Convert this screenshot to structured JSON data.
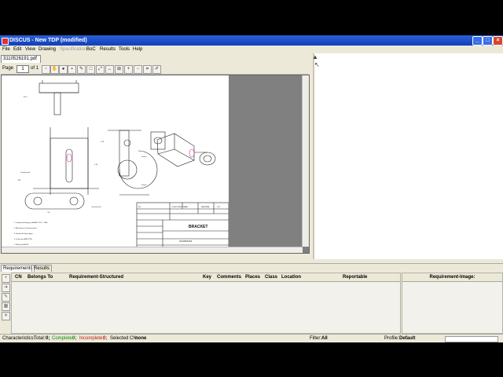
{
  "window": {
    "title": "DISCUS - New TDP (modified)",
    "controls": [
      "_",
      "□",
      "×"
    ]
  },
  "menu": [
    "File",
    "Edit",
    "View",
    "Drawing",
    "Specification",
    "BoC",
    "Results",
    "Tools",
    "Help"
  ],
  "document": {
    "tab_label": "3110526191.pdf",
    "toolbar": {
      "page_label": "Page",
      "page_value": "1",
      "page_of": "of 1"
    }
  },
  "drawing": {
    "title_block_title": "BRACKET",
    "part_number": "3110526191",
    "notes": [
      "1. Interpret drawing per ASME Y14.5 - 1994.",
      "2. All surfaces 63 microinches.",
      "3. Break all sharp edges.",
      "4. Finish per AMS 2700.",
      "5. Mark per AS478."
    ]
  },
  "bottom": {
    "tabs": [
      "Requirements",
      "Results"
    ],
    "active_tab": "Requirements",
    "grid_columns": [
      "CN",
      "Belongs To",
      "Requirement-Structured",
      "Key",
      "Comments",
      "Places",
      "Class",
      "Location",
      "Reportable"
    ],
    "image_panel_title": "Requirement-Image:"
  },
  "status": {
    "characteristics_label": "Characteristics:",
    "total_label": "Total:",
    "total_value": "0;",
    "complete_label": "Complete:",
    "complete_value": "0;",
    "incomplete_label": "Incomplete:",
    "incomplete_value": "0;",
    "selected_label": "Selected CN:",
    "selected_value": "none",
    "filter_label": "Filter:",
    "filter_value": "All",
    "profile_label": "Profile:",
    "profile_value": "Default"
  },
  "colors": {
    "titlebar": "#1f54d0",
    "complete": "#0a8a0a",
    "incomplete": "#c01818",
    "viewer_background": "#808080"
  }
}
